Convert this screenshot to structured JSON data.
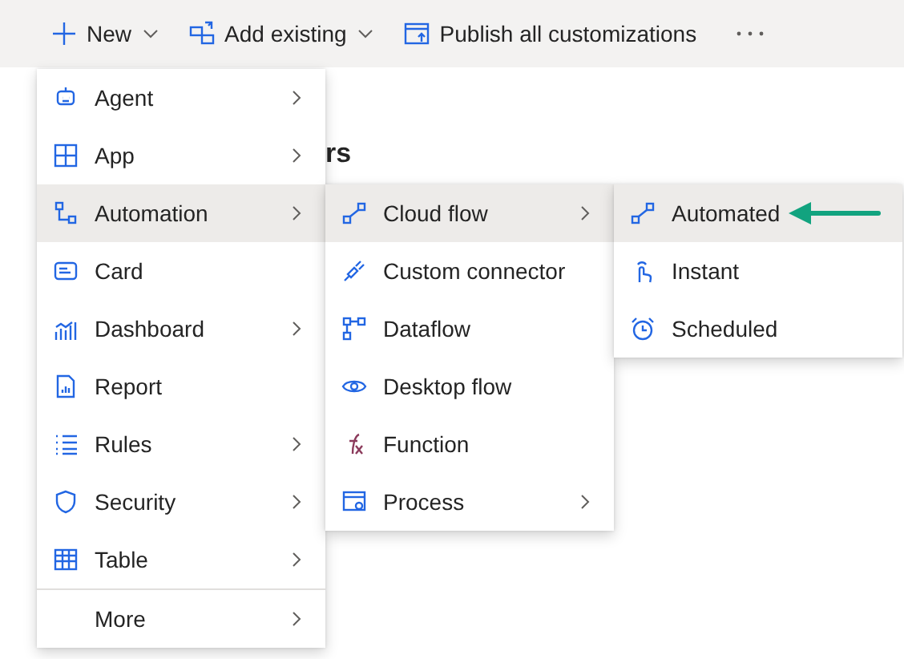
{
  "toolbar": [
    {
      "label": "New",
      "dropdown": true
    },
    {
      "label": "Add existing",
      "dropdown": true
    },
    {
      "label": "Publish all customizations",
      "dropdown": false
    }
  ],
  "page_heading": "rs",
  "menus": [
    {
      "items": [
        {
          "label": "Agent",
          "submenu": true,
          "selected": false
        },
        {
          "label": "App",
          "submenu": true,
          "selected": false
        },
        {
          "label": "Automation",
          "submenu": true,
          "selected": true
        },
        {
          "label": "Card",
          "submenu": false,
          "selected": false
        },
        {
          "label": "Dashboard",
          "submenu": true,
          "selected": false
        },
        {
          "label": "Report",
          "submenu": false,
          "selected": false
        },
        {
          "label": "Rules",
          "submenu": true,
          "selected": false
        },
        {
          "label": "Security",
          "submenu": true,
          "selected": false
        },
        {
          "label": "Table",
          "submenu": true,
          "selected": false
        },
        {
          "label": "More",
          "submenu": true,
          "selected": false,
          "divider_before": true
        }
      ]
    },
    {
      "items": [
        {
          "label": "Cloud flow",
          "submenu": true,
          "selected": true
        },
        {
          "label": "Custom connector",
          "submenu": false,
          "selected": false
        },
        {
          "label": "Dataflow",
          "submenu": false,
          "selected": false
        },
        {
          "label": "Desktop flow",
          "submenu": false,
          "selected": false
        },
        {
          "label": "Function",
          "submenu": false,
          "selected": false
        },
        {
          "label": "Process",
          "submenu": true,
          "selected": false
        }
      ]
    },
    {
      "items": [
        {
          "label": "Automated",
          "submenu": false,
          "selected": true
        },
        {
          "label": "Instant",
          "submenu": false,
          "selected": false
        },
        {
          "label": "Scheduled",
          "submenu": false,
          "selected": false
        }
      ]
    }
  ]
}
